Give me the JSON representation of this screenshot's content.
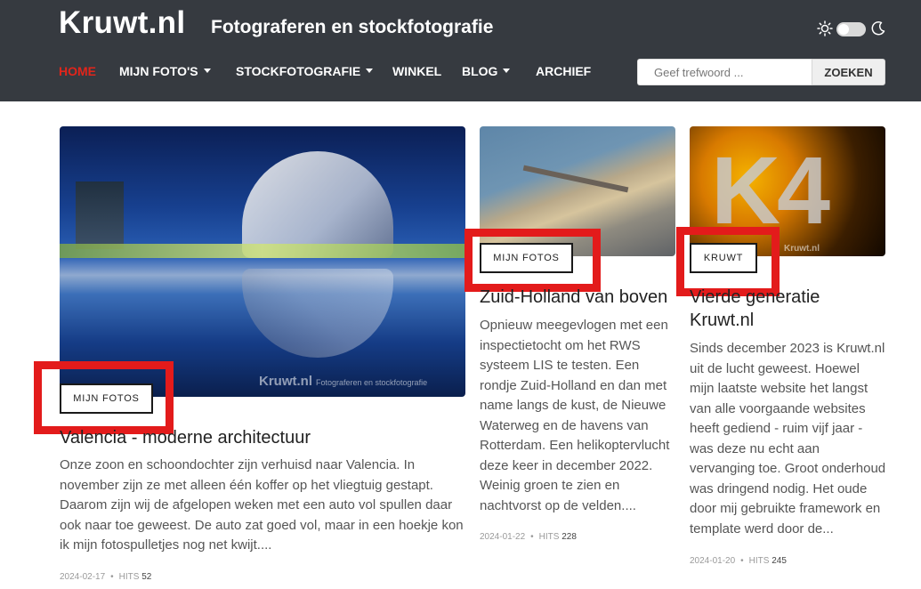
{
  "site": {
    "logo": "Kruwt.nl",
    "tagline": "Fotograferen en stockfotografie"
  },
  "theme_toggle": {
    "sun_icon": "sun-icon",
    "moon_icon": "moon-icon",
    "dark_mode": false
  },
  "nav": {
    "items": [
      {
        "label": "HOME",
        "active": true,
        "dropdown": false
      },
      {
        "label": "MIJN FOTO'S",
        "active": false,
        "dropdown": true
      },
      {
        "label": "STOCKFOTOGRAFIE",
        "active": false,
        "dropdown": true
      },
      {
        "label": "WINKEL",
        "active": false,
        "dropdown": false
      },
      {
        "label": "BLOG",
        "active": false,
        "dropdown": true
      },
      {
        "label": "ARCHIEF",
        "active": false,
        "dropdown": false
      }
    ]
  },
  "search": {
    "placeholder": "Geef trefwoord ...",
    "value": "",
    "button": "ZOEKEN"
  },
  "colors": {
    "header_bg": "#363a40",
    "active_nav": "#e1251b",
    "highlight": "#e31b1b"
  },
  "articles": [
    {
      "category": "MIJN FOTOS",
      "image_watermark": "Kruwt.nl",
      "image_watermark_sub": "Fotograferen en stockfotografie",
      "title": "Valencia - moderne architectuur",
      "intro": "Onze zoon en schoondochter zijn verhuisd naar Valencia. In november zijn ze met alleen één koffer op het vliegtuig gestapt. Daarom zijn wij de afgelopen weken met een auto vol spullen daar ook naar toe geweest. De auto zat goed vol, maar in een hoekje kon ik mijn fotospulletjes nog net kwijt....",
      "date": "2024-02-17",
      "hits_label": "HITS",
      "hits": "52"
    },
    {
      "category": "MIJN FOTOS",
      "title": "Zuid-Holland van boven",
      "intro": "Opnieuw meegevlogen met een inspectietocht om het RWS systeem LIS te testen. Een rondje Zuid-Holland en dan met name langs de kust, de Nieuwe Waterweg en de havens van Rotterdam. Een helikoptervlucht deze keer in december 2022. Weinig groen te zien en nachtvorst op de velden....",
      "date": "2024-01-22",
      "hits_label": "HITS",
      "hits": "228"
    },
    {
      "category": "KRUWT",
      "image_text": "K4",
      "image_watermark": "Kruwt.nl",
      "title": "Vierde generatie Kruwt.nl",
      "intro": "Sinds december 2023 is Kruwt.nl uit de lucht geweest. Hoewel mijn laatste website het langst van alle voorgaande websites heeft gediend - ruim vijf jaar - was deze nu echt aan vervanging toe. Groot onderhoud was dringend nodig. Het oude door mij gebruikte framework en template werd door de...",
      "date": "2024-01-20",
      "hits_label": "HITS",
      "hits": "245"
    }
  ]
}
